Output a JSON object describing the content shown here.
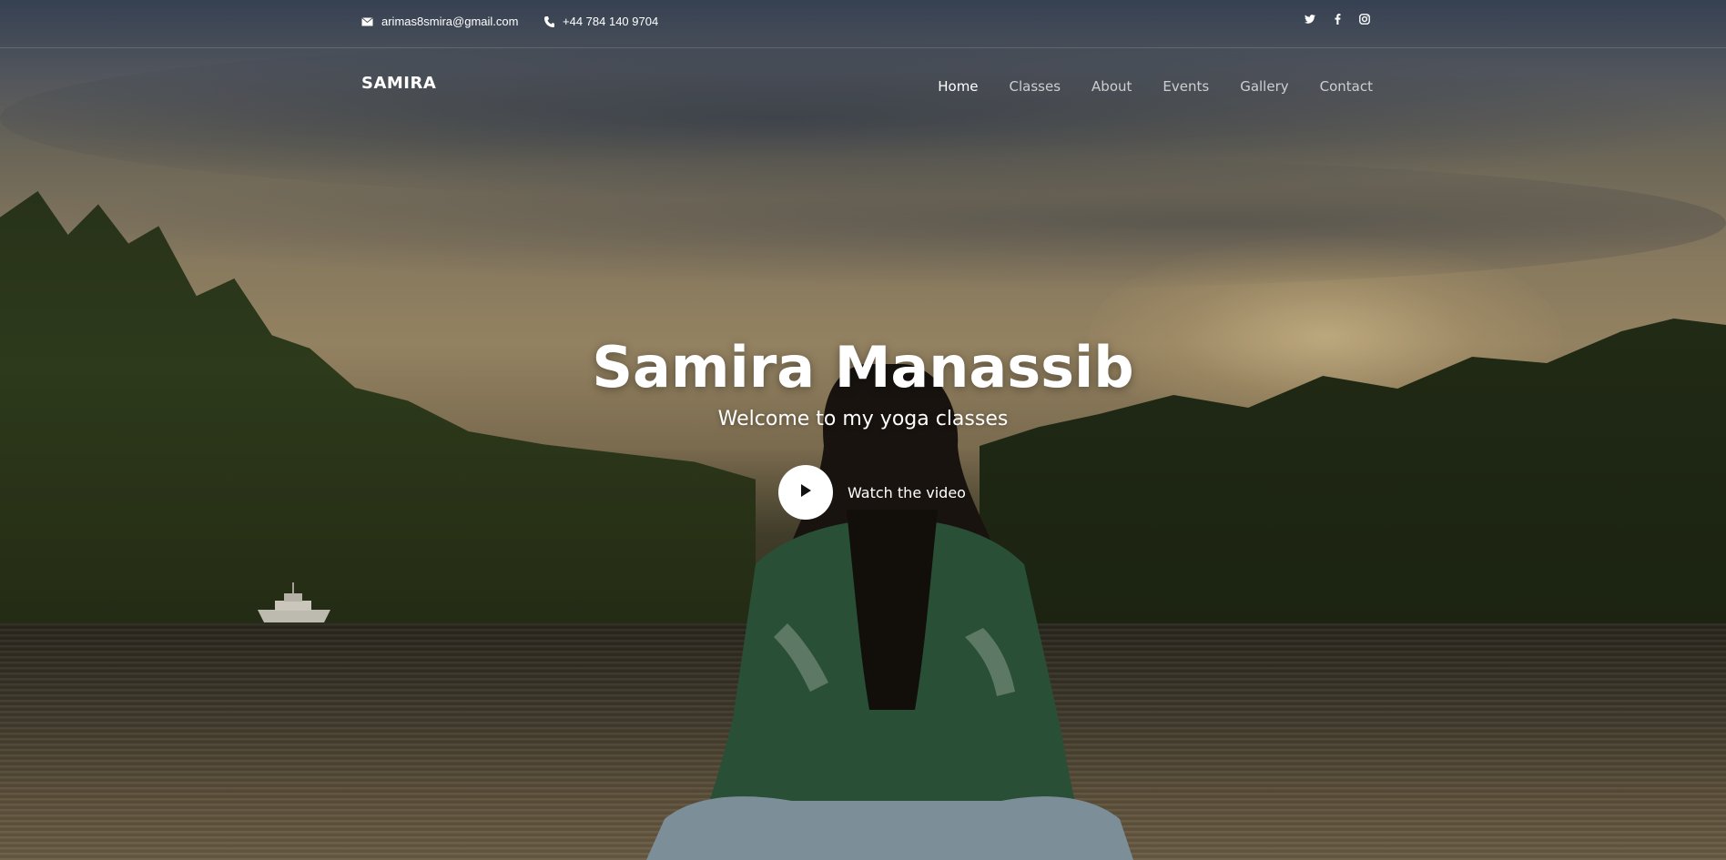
{
  "topbar": {
    "email": "arimas8smira@gmail.com",
    "phone": "+44 784 140 9704",
    "social": [
      "twitter-icon",
      "facebook-icon",
      "instagram-icon"
    ]
  },
  "nav": {
    "brand": "SAMIRA",
    "items": [
      {
        "label": "Home",
        "active": true
      },
      {
        "label": "Classes",
        "active": false
      },
      {
        "label": "About",
        "active": false
      },
      {
        "label": "Events",
        "active": false
      },
      {
        "label": "Gallery",
        "active": false
      },
      {
        "label": "Contact",
        "active": false
      }
    ]
  },
  "hero": {
    "title": "Samira Manassib",
    "subtitle": "Welcome to my yoga classes",
    "video_label": "Watch the video"
  },
  "colors": {
    "text": "#ffffff",
    "nav_inactive": "rgba(255,255,255,0.72)",
    "play_button": "#ffffff"
  }
}
